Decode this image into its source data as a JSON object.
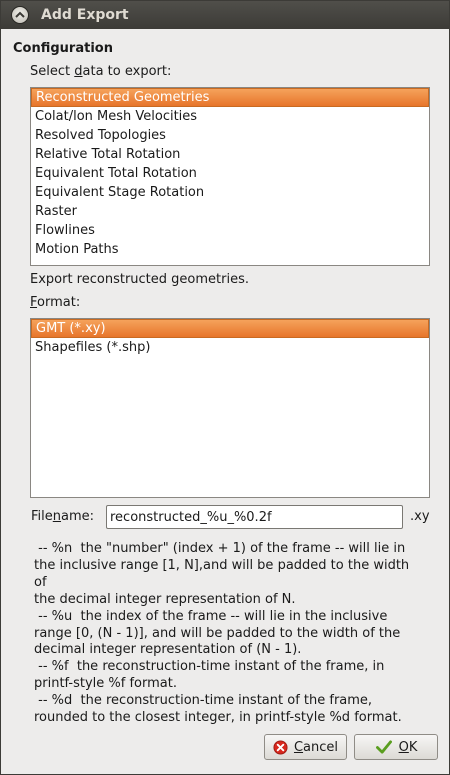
{
  "window": {
    "title": "Add Export"
  },
  "configuration": {
    "heading": "Configuration"
  },
  "data_list": {
    "label_pre": "Select ",
    "label_mnemonic": "d",
    "label_post": "ata to export:",
    "items": [
      "Reconstructed Geometries",
      "Colat/lon Mesh Velocities",
      "Resolved Topologies",
      "Relative Total Rotation",
      "Equivalent Total Rotation",
      "Equivalent Stage Rotation",
      "Raster",
      "Flowlines",
      "Motion Paths"
    ],
    "selected_index": 0
  },
  "description": "Export reconstructed geometries.",
  "format_list": {
    "label_mnemonic": "F",
    "label_post": "ormat:",
    "items": [
      "GMT (*.xy)",
      "Shapefiles (*.shp)"
    ],
    "selected_index": 0
  },
  "filename": {
    "label_pre": "File",
    "label_mnemonic": "n",
    "label_post": "ame:",
    "value": "reconstructed_%u_%0.2f",
    "extension": ".xy"
  },
  "help_text": " -- %n  the \"number\" (index + 1) of the frame -- will lie in\nthe inclusive range [1, N],and will be padded to the width of\nthe decimal integer representation of N.\n -- %u  the index of the frame -- will lie in the inclusive\nrange [0, (N - 1)], and will be padded to the width of the\ndecimal integer representation of (N - 1).\n -- %f  the reconstruction-time instant of the frame, in\nprintf-style %f format.\n -- %d  the reconstruction-time instant of the frame,\nrounded to the closest integer, in printf-style %d format.",
  "buttons": {
    "cancel_mnemonic": "C",
    "cancel_post": "ancel",
    "ok_mnemonic": "O",
    "ok_post": "K"
  },
  "colors": {
    "selection": "#f0883e",
    "titlebar": "#3c3b37",
    "window": "#edeceb"
  }
}
